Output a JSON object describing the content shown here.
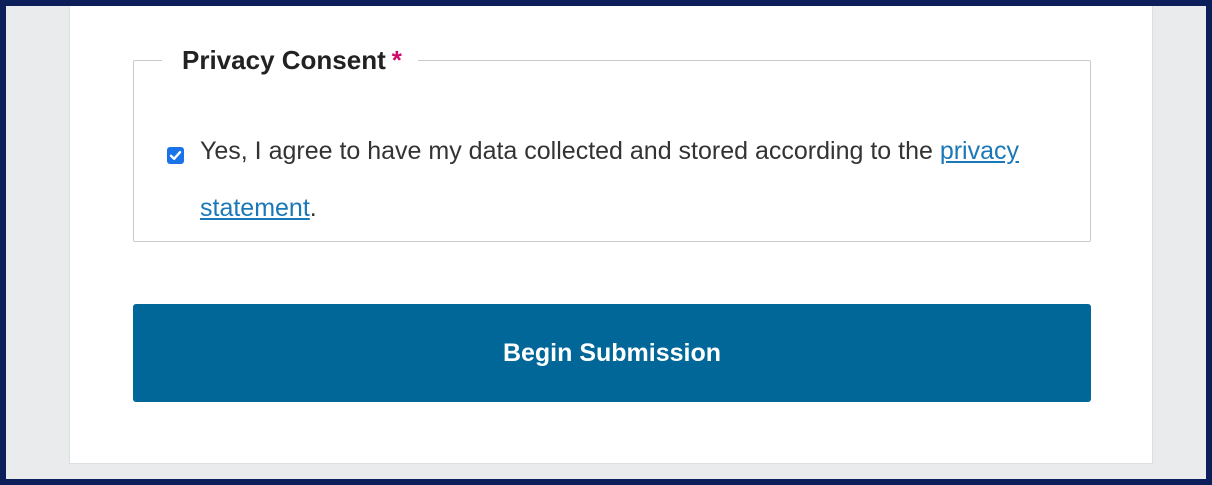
{
  "consent": {
    "legend": "Privacy Consent",
    "required_marker": "*",
    "checked": true,
    "text_before_link": "Yes, I agree to have my data collected and stored according to the ",
    "link_text": "privacy statement",
    "text_after_link": "."
  },
  "submit": {
    "label": "Begin Submission"
  },
  "colors": {
    "frame_border": "#0c1f5a",
    "page_background": "#e9ebec",
    "button_background": "#006798",
    "required_star": "#d00a6c",
    "link": "#1b78b8",
    "checkbox": "#1a73e8"
  },
  "icons": {
    "checkbox": "checkmark-icon"
  }
}
